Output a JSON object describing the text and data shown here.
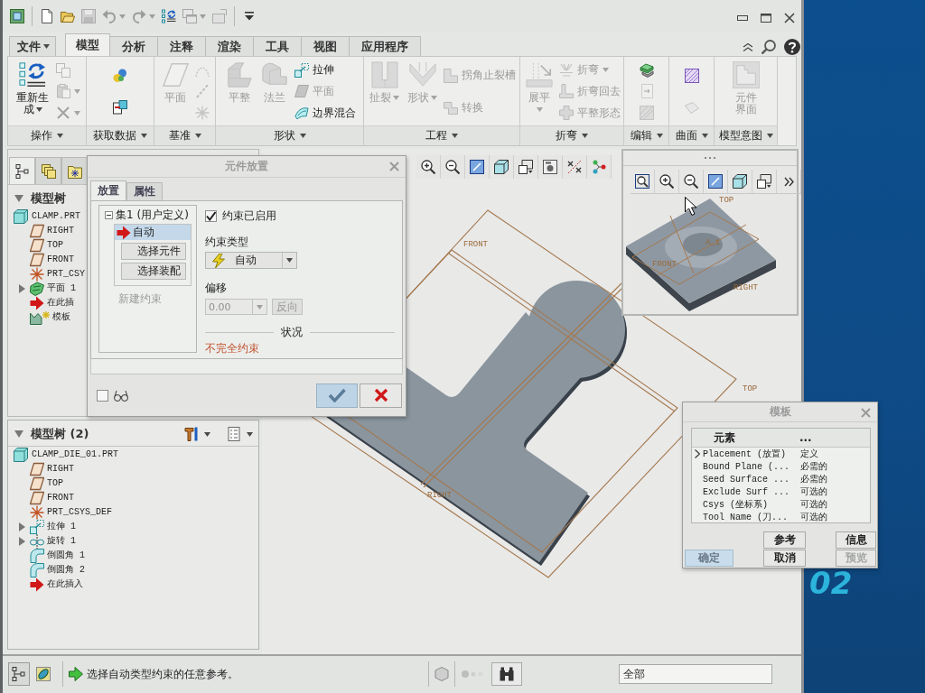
{
  "quick_access": [
    {
      "disabled": false,
      "dropdown": false
    },
    {
      "disabled": false,
      "dropdown": false
    },
    {
      "disabled": false,
      "dropdown": false
    },
    {
      "disabled": true,
      "dropdown": false
    },
    {
      "disabled": true,
      "dropdown": true
    },
    {
      "disabled": true,
      "dropdown": true
    },
    {
      "disabled": false,
      "dropdown": false
    },
    {
      "disabled": true,
      "dropdown": true
    },
    {
      "disabled": true,
      "dropdown": false
    },
    {
      "disabled": false,
      "dropdown": false
    }
  ],
  "ribbon": {
    "tabs": [
      {
        "label": "文件",
        "selected": false,
        "dropdown": true
      },
      {
        "label": "模型",
        "selected": true,
        "dropdown": false
      },
      {
        "label": "分析",
        "selected": false,
        "dropdown": false
      },
      {
        "label": "注释",
        "selected": false,
        "dropdown": false
      },
      {
        "label": "渲染",
        "selected": false,
        "dropdown": false
      },
      {
        "label": "工具",
        "selected": false,
        "dropdown": false
      },
      {
        "label": "视图",
        "selected": false,
        "dropdown": false
      },
      {
        "label": "应用程序",
        "selected": false,
        "dropdown": false
      }
    ],
    "groups": [
      {
        "label": "操作",
        "items": [
          {
            "kind": "large",
            "label": "重新生成",
            "dropdown": true,
            "disabled": false
          },
          {
            "kind": "small",
            "dropdown": false,
            "disabled": true
          },
          {
            "kind": "small",
            "dropdown": true,
            "disabled": true
          },
          {
            "kind": "small",
            "dropdown": true,
            "disabled": true
          }
        ]
      },
      {
        "label": "获取数据",
        "items": [
          {
            "kind": "small",
            "dropdown": false,
            "disabled": false
          },
          {
            "kind": "small",
            "dropdown": false,
            "disabled": false
          }
        ]
      },
      {
        "label": "基准",
        "items": [
          {
            "kind": "large",
            "label": "平面",
            "dropdown": false,
            "disabled": true
          },
          {
            "kind": "small",
            "dropdown": false,
            "disabled": true
          },
          {
            "kind": "small",
            "dropdown": false,
            "disabled": true
          },
          {
            "kind": "small",
            "dropdown": false,
            "disabled": true
          }
        ]
      },
      {
        "label": "形状",
        "items": [
          {
            "kind": "large",
            "label": "平整",
            "dropdown": false,
            "disabled": true
          },
          {
            "kind": "large",
            "label": "法兰",
            "dropdown": false,
            "disabled": true
          },
          {
            "kind": "small",
            "label": "拉伸",
            "dropdown": false,
            "disabled": false
          },
          {
            "kind": "small",
            "label": "平面",
            "dropdown": false,
            "disabled": true
          },
          {
            "kind": "small",
            "label": "边界混合",
            "dropdown": false,
            "disabled": false
          }
        ]
      },
      {
        "label": "工程",
        "items": [
          {
            "kind": "large",
            "label": "扯裂",
            "dropdown": true,
            "disabled": true
          },
          {
            "kind": "large",
            "label": "形状",
            "dropdown": true,
            "disabled": true
          },
          {
            "kind": "small",
            "label": "拐角止裂槽",
            "dropdown": false,
            "disabled": true
          },
          {
            "kind": "small",
            "label": "转换",
            "dropdown": false,
            "disabled": true
          }
        ]
      },
      {
        "label": "折弯",
        "items": [
          {
            "kind": "large",
            "label": "展平",
            "dropdown": true,
            "disabled": true
          },
          {
            "kind": "small",
            "label": "折弯",
            "dropdown": true,
            "disabled": true
          },
          {
            "kind": "small",
            "label": "折弯回去",
            "dropdown": false,
            "disabled": true
          },
          {
            "kind": "small",
            "label": "平整形态",
            "dropdown": false,
            "disabled": true
          }
        ]
      },
      {
        "label": "编辑",
        "items": [
          {
            "kind": "small",
            "dropdown": false,
            "disabled": false
          },
          {
            "kind": "small",
            "dropdown": false,
            "disabled": true
          },
          {
            "kind": "small",
            "dropdown": false,
            "disabled": true
          }
        ]
      },
      {
        "label": "曲面",
        "items": [
          {
            "kind": "small",
            "dropdown": false,
            "disabled": false
          },
          {
            "kind": "small",
            "dropdown": false,
            "disabled": true
          }
        ]
      },
      {
        "label": "模型意图",
        "items": [
          {
            "kind": "large",
            "label": "元件界面",
            "dropdown": false,
            "disabled": true
          }
        ]
      }
    ]
  },
  "navigator": {
    "tabs": [
      {
        "selected": true
      },
      {
        "selected": false
      },
      {
        "selected": false
      }
    ]
  },
  "model_tree": {
    "title": "模型树",
    "expanded": true,
    "items": [
      {
        "label": "CLAMP.PRT",
        "kind": "part",
        "collapsed": false,
        "children": [
          {
            "label": "RIGHT",
            "kind": "plane",
            "collapsed": false
          },
          {
            "label": "TOP",
            "kind": "plane",
            "collapsed": false
          },
          {
            "label": "FRONT",
            "kind": "plane",
            "collapsed": false
          },
          {
            "label": "PRT_CSY",
            "kind": "csys",
            "collapsed": false
          },
          {
            "label": "平面 1",
            "kind": "surface",
            "collapsed": true
          },
          {
            "label": "在此插",
            "kind": "insert",
            "collapsed": false
          },
          {
            "label": "模板",
            "kind": "template",
            "collapsed": false
          }
        ]
      }
    ]
  },
  "model_tree_2": {
    "title": "模型树 (2)",
    "expanded": true,
    "items": [
      {
        "label": "CLAMP_DIE_01.PRT",
        "kind": "part",
        "collapsed": false,
        "children": [
          {
            "label": "RIGHT",
            "kind": "plane",
            "collapsed": false
          },
          {
            "label": "TOP",
            "kind": "plane",
            "collapsed": false
          },
          {
            "label": "FRONT",
            "kind": "plane",
            "collapsed": false
          },
          {
            "label": "PRT_CSYS_DEF",
            "kind": "csys",
            "collapsed": false
          },
          {
            "label": "拉伸 1",
            "kind": "extrude",
            "collapsed": true
          },
          {
            "label": "旋转 1",
            "kind": "revolve",
            "collapsed": true
          },
          {
            "label": "倒圆角 1",
            "kind": "round",
            "collapsed": false
          },
          {
            "label": "倒圆角 2",
            "kind": "round",
            "collapsed": false
          },
          {
            "label": "在此插入",
            "kind": "insert",
            "collapsed": false
          }
        ]
      }
    ]
  },
  "graphics": {
    "datum_labels": [
      "FRONT",
      "TOP",
      "RIGHT"
    ],
    "preview": {
      "datum_labels": [
        "TOP",
        "A_1",
        "FRONT",
        "RIGHT"
      ]
    }
  },
  "component_placement": {
    "title": "元件放置",
    "tabs": [
      {
        "label": "放置",
        "selected": true
      },
      {
        "label": "属性",
        "selected": false
      }
    ],
    "sets": [
      {
        "label": "集1 (用户定义)",
        "expanded": true,
        "constraints": [
          {
            "label": "自动",
            "selected": true
          }
        ]
      }
    ],
    "collectors": [
      "选择元件",
      "选择装配"
    ],
    "new_constraint": {
      "label": "新建约束",
      "disabled": true
    },
    "constraint_enabled": {
      "label": "约束已启用",
      "checked": true
    },
    "constraint_type": {
      "label": "约束类型",
      "value": "自动"
    },
    "offset": {
      "label": "偏移",
      "value": "0.00",
      "disabled": true
    },
    "flip": {
      "label": "反向",
      "disabled": true
    },
    "status": {
      "label": "状况",
      "value": "不完全约束"
    },
    "preview_checkbox": {
      "checked": false
    }
  },
  "template_dialog": {
    "title": "模板",
    "columns": [
      "元素",
      "..."
    ],
    "rows": [
      {
        "element": "Placement (放置)",
        "status": "定义",
        "current": true
      },
      {
        "element": "Bound Plane (...",
        "status": "必需的",
        "current": false
      },
      {
        "element": "Seed Surface ...",
        "status": "必需的",
        "current": false
      },
      {
        "element": "Exclude Surf ...",
        "status": "可选的",
        "current": false
      },
      {
        "element": "Csys (坐标系)",
        "status": "可选的",
        "current": false
      },
      {
        "element": "Tool Name (刀...",
        "status": "可选的",
        "current": false
      }
    ],
    "buttons": [
      {
        "label": "参考",
        "default": false,
        "disabled": false
      },
      {
        "label": "信息",
        "default": false,
        "disabled": false
      },
      {
        "label": "确定",
        "default": true,
        "disabled": false
      },
      {
        "label": "取消",
        "default": false,
        "disabled": false
      },
      {
        "label": "预览",
        "default": false,
        "disabled": true
      }
    ]
  },
  "status_bar": {
    "message": "选择自动类型约束的任意参考。",
    "filter": "全部"
  },
  "desktop": {
    "text": "02"
  }
}
